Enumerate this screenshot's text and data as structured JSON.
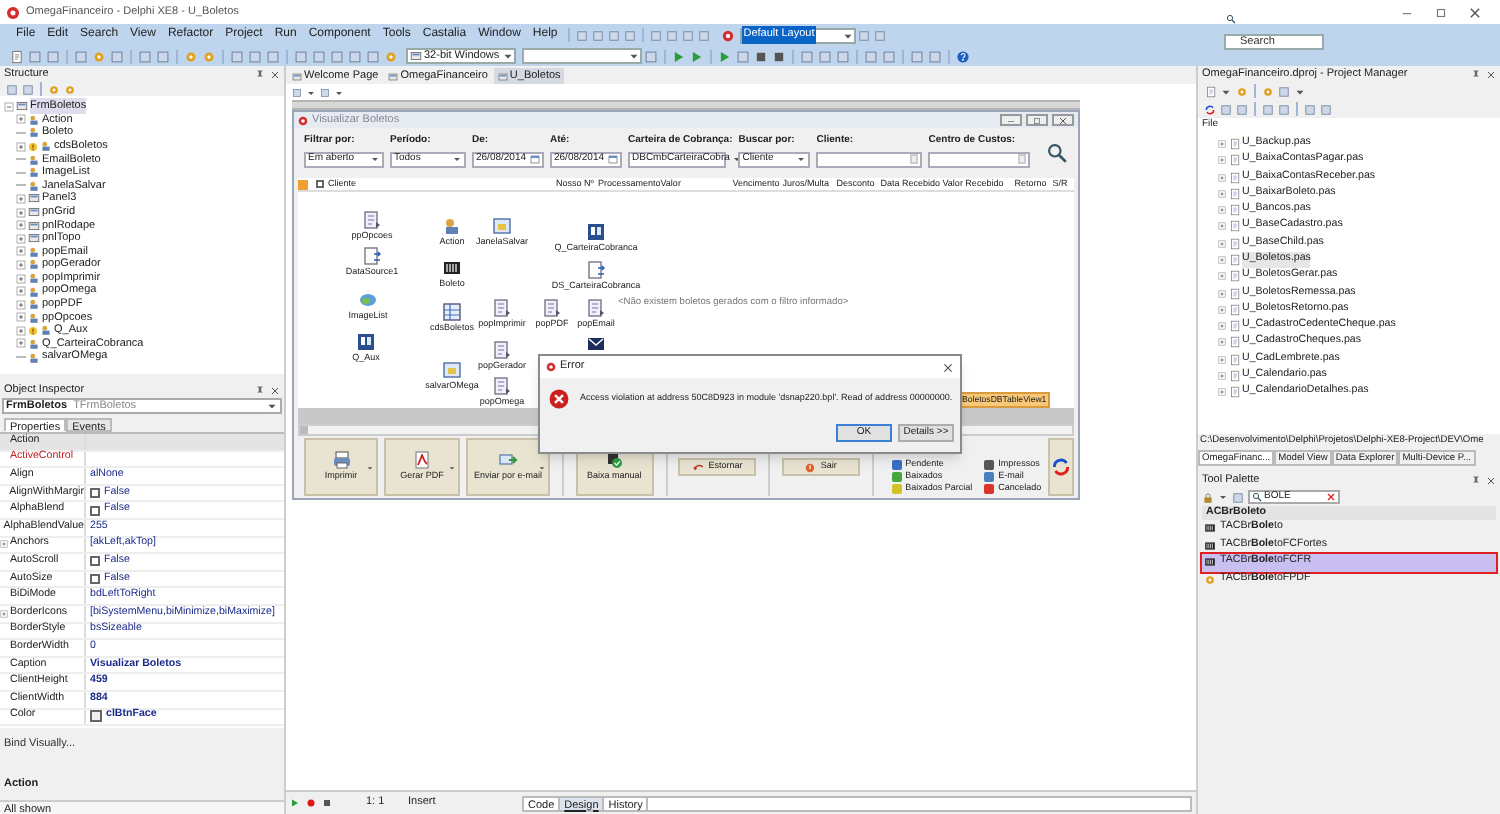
{
  "window": {
    "title": "OmegaFinanceiro - Delphi XE8 - U_Boletos"
  },
  "menu": [
    "File",
    "Edit",
    "Search",
    "View",
    "Refactor",
    "Project",
    "Run",
    "Component",
    "Tools",
    "Castalia",
    "Window",
    "Help"
  ],
  "layout_combo": {
    "value": "Default Layout"
  },
  "ide_search": {
    "placeholder": "Search"
  },
  "platform_combo": {
    "value": "32-bit Windows"
  },
  "structure": {
    "title": "Structure",
    "root": {
      "label": "FrmBoletos",
      "expanded": true,
      "children": [
        {
          "label": "Action",
          "kind": "component",
          "expandable": true,
          "warning": false
        },
        {
          "label": "Boleto",
          "kind": "component",
          "expandable": false,
          "warning": false
        },
        {
          "label": "cdsBoletos",
          "kind": "component",
          "expandable": true,
          "warning": true
        },
        {
          "label": "EmailBoleto",
          "kind": "component",
          "expandable": false,
          "warning": false
        },
        {
          "label": "ImageList",
          "kind": "component",
          "expandable": false,
          "warning": false
        },
        {
          "label": "JanelaSalvar",
          "kind": "component",
          "expandable": false,
          "warning": false
        },
        {
          "label": "Panel3",
          "kind": "panel",
          "expandable": true,
          "warning": false
        },
        {
          "label": "pnGrid",
          "kind": "panel",
          "expandable": true,
          "warning": false
        },
        {
          "label": "pnlRodape",
          "kind": "panel",
          "expandable": true,
          "warning": false
        },
        {
          "label": "pnlTopo",
          "kind": "panel",
          "expandable": true,
          "warning": false
        },
        {
          "label": "popEmail",
          "kind": "component",
          "expandable": true,
          "warning": false
        },
        {
          "label": "popGerador",
          "kind": "component",
          "expandable": true,
          "warning": false
        },
        {
          "label": "popImprimir",
          "kind": "component",
          "expandable": true,
          "warning": false
        },
        {
          "label": "popOmega",
          "kind": "component",
          "expandable": true,
          "warning": false
        },
        {
          "label": "popPDF",
          "kind": "component",
          "expandable": true,
          "warning": false
        },
        {
          "label": "ppOpcoes",
          "kind": "component",
          "expandable": true,
          "warning": false
        },
        {
          "label": "Q_Aux",
          "kind": "component",
          "expandable": true,
          "warning": true
        },
        {
          "label": "Q_CarteiraCobranca",
          "kind": "component",
          "expandable": true,
          "warning": false
        },
        {
          "label": "salvarOMega",
          "kind": "component",
          "expandable": false,
          "warning": false
        }
      ]
    }
  },
  "object_inspector": {
    "title": "Object Inspector",
    "component": "FrmBoletos",
    "class": "TFrmBoletos",
    "tabs": [
      {
        "label": "Properties",
        "selected": true
      },
      {
        "label": "Events",
        "selected": false
      }
    ],
    "properties": [
      {
        "name": "Action",
        "kind": "text",
        "selected": true,
        "expandable": false,
        "reference": false
      },
      {
        "name": "ActiveControl",
        "kind": "text",
        "selected": false,
        "expandable": false,
        "reference": true
      },
      {
        "name": "Align",
        "value": "alNone",
        "kind": "text",
        "selected": false,
        "expandable": false,
        "reference": false,
        "modified": false
      },
      {
        "name": "AlignWithMargir",
        "value": "False",
        "kind": "check",
        "checked": false,
        "selected": false,
        "expandable": false,
        "reference": false,
        "modified": false
      },
      {
        "name": "AlphaBlend",
        "value": "False",
        "kind": "check",
        "checked": false,
        "selected": false,
        "expandable": false,
        "reference": false,
        "modified": false
      },
      {
        "name": "AlphaBlendValue",
        "value": "255",
        "kind": "text",
        "selected": false,
        "expandable": false,
        "reference": false,
        "modified": false
      },
      {
        "name": "Anchors",
        "value": "[akLeft,akTop]",
        "kind": "text",
        "selected": false,
        "expandable": true,
        "reference": false,
        "modified": false
      },
      {
        "name": "AutoScroll",
        "value": "False",
        "kind": "check",
        "checked": false,
        "selected": false,
        "expandable": false,
        "reference": false,
        "modified": false
      },
      {
        "name": "AutoSize",
        "value": "False",
        "kind": "check",
        "checked": false,
        "selected": false,
        "expandable": false,
        "reference": false,
        "modified": false
      },
      {
        "name": "BiDiMode",
        "value": "bdLeftToRight",
        "kind": "text",
        "selected": false,
        "expandable": false,
        "reference": false,
        "modified": false
      },
      {
        "name": "BorderIcons",
        "value": "[biSystemMenu,biMinimize,biMaximize]",
        "kind": "text",
        "selected": false,
        "expandable": true,
        "reference": false,
        "modified": false
      },
      {
        "name": "BorderStyle",
        "value": "bsSizeable",
        "kind": "text",
        "selected": false,
        "expandable": false,
        "reference": false,
        "modified": false
      },
      {
        "name": "BorderWidth",
        "value": "0",
        "kind": "text",
        "selected": false,
        "expandable": false,
        "reference": false,
        "modified": false
      },
      {
        "name": "Caption",
        "value": "Visualizar Boletos",
        "kind": "text",
        "selected": false,
        "expandable": false,
        "reference": false,
        "modified": true
      },
      {
        "name": "ClientHeight",
        "value": "459",
        "kind": "text",
        "selected": false,
        "expandable": false,
        "reference": false,
        "modified": true
      },
      {
        "name": "ClientWidth",
        "value": "884",
        "kind": "text",
        "selected": false,
        "expandable": false,
        "reference": false,
        "modified": true
      },
      {
        "name": "Color",
        "value": "clBtnFace",
        "kind": "color",
        "selected": false,
        "expandable": false,
        "reference": false,
        "modified": true
      }
    ],
    "bind_link": "Bind Visually...",
    "help_title": "Action",
    "status": "All shown"
  },
  "editor_tabs": [
    {
      "label": "Welcome Page",
      "selected": false
    },
    {
      "label": "OmegaFinanceiro",
      "selected": false
    },
    {
      "label": "U_Boletos",
      "selected": true
    }
  ],
  "form": {
    "title": "Visualizar Boletos",
    "filters": [
      {
        "label": "Filtrar por:",
        "value": "Em aberto",
        "kind": "combo"
      },
      {
        "label": "Período:",
        "value": "Todos",
        "kind": "combo"
      },
      {
        "label": "De:",
        "value": "26/08/2014",
        "kind": "date"
      },
      {
        "label": "Até:",
        "value": "26/08/2014",
        "kind": "date"
      },
      {
        "label": "Carteira de Cobrança:",
        "value": "DBCmbCarteiraCobra",
        "kind": "combo"
      },
      {
        "label": "Buscar por:",
        "value": "Cliente",
        "kind": "combo"
      },
      {
        "label": "Cliente:",
        "kind": "edit"
      },
      {
        "label": "Centro de Custos:",
        "kind": "edit"
      }
    ],
    "grid": {
      "select_all_checked": false,
      "columns": [
        "Cliente",
        "Nosso Nº",
        "Processamento",
        "Valor",
        "Vencimento",
        "Juros/Multa",
        "Desconto",
        "Data Recebido",
        "Valor Recebido",
        "Retorno",
        "S/R"
      ],
      "empty_message": "<Não existem boletos gerados com o filtro informado>",
      "view_label": "BoletosDBTableView1"
    },
    "components": [
      {
        "label": "ppOpcoes",
        "kind": "popup"
      },
      {
        "label": "DataSource1",
        "kind": "datasource"
      },
      {
        "label": "ImageList",
        "kind": "imagelist"
      },
      {
        "label": "Q_Aux",
        "kind": "query"
      },
      {
        "label": "Action",
        "kind": "action"
      },
      {
        "label": "JanelaSalvar",
        "kind": "dialog"
      },
      {
        "label": "Boleto",
        "kind": "boleto"
      },
      {
        "label": "cdsBoletos",
        "kind": "dataset"
      },
      {
        "label": "salvarOMega",
        "kind": "dialog"
      },
      {
        "label": "popImprimir",
        "kind": "popup"
      },
      {
        "label": "popPDF",
        "kind": "popup"
      },
      {
        "label": "popEmail",
        "kind": "popup"
      },
      {
        "label": "popGerador",
        "kind": "popup"
      },
      {
        "label": "popOmega",
        "kind": "popup"
      },
      {
        "label": "Q_CarteiraCobranca",
        "kind": "query"
      },
      {
        "label": "DS_CarteiraCobranca",
        "kind": "datasource"
      },
      {
        "kind": "email"
      }
    ],
    "buttons": [
      {
        "label": "Imprimir",
        "dropdown": true
      },
      {
        "label": "Gerar PDF",
        "dropdown": true
      },
      {
        "label": "Enviar por e-mail",
        "dropdown": true
      },
      {
        "label": "Baixa manual",
        "dropdown": false
      },
      {
        "label": "Estornar",
        "dropdown": false
      },
      {
        "label": "Sair",
        "dropdown": false
      }
    ],
    "legend": [
      {
        "label": "Pendente",
        "color": "#3b6fc6"
      },
      {
        "label": "Baixados",
        "color": "#46a83c"
      },
      {
        "label": "Baixados Parcial",
        "color": "#d2c226"
      },
      {
        "label": "Impressos",
        "color": "#555555"
      },
      {
        "label": "E-mail",
        "color": "#4a7fc1"
      },
      {
        "label": "Cancelado",
        "color": "#d9362b"
      }
    ]
  },
  "error_dialog": {
    "title": "Error",
    "message": "Access violation at address 50C8D923 in module 'dsnap220.bpl'. Read of address 00000000.",
    "buttons": [
      {
        "label": "OK",
        "default": true
      },
      {
        "label": "Details >>",
        "default": false
      }
    ]
  },
  "editor_status": {
    "position": "1: 1",
    "mode": "Insert",
    "tabs": [
      {
        "label": "Code",
        "selected": false
      },
      {
        "label": "Design",
        "selected": true
      },
      {
        "label": "History",
        "selected": false
      }
    ]
  },
  "project_manager": {
    "title": "OmegaFinanceiro.dproj - Project Manager",
    "column": "File",
    "files": [
      {
        "label": "U_Backup.pas",
        "selected": false
      },
      {
        "label": "U_BaixaContasPagar.pas",
        "selected": false
      },
      {
        "label": "U_BaixaContasReceber.pas",
        "selected": false
      },
      {
        "label": "U_BaixarBoleto.pas",
        "selected": false
      },
      {
        "label": "U_Bancos.pas",
        "selected": false
      },
      {
        "label": "U_BaseCadastro.pas",
        "selected": false
      },
      {
        "label": "U_BaseChild.pas",
        "selected": false
      },
      {
        "label": "U_Boletos.pas",
        "selected": true
      },
      {
        "label": "U_BoletosGerar.pas",
        "selected": false
      },
      {
        "label": "U_BoletosRemessa.pas",
        "selected": false
      },
      {
        "label": "U_BoletosRetorno.pas",
        "selected": false
      },
      {
        "label": "U_CadastroCedenteCheque.pas",
        "selected": false
      },
      {
        "label": "U_CadastroCheques.pas",
        "selected": false
      },
      {
        "label": "U_CadLembrete.pas",
        "selected": false
      },
      {
        "label": "U_Calendario.pas",
        "selected": false
      },
      {
        "label": "U_CalendarioDetalhes.pas",
        "selected": false
      }
    ],
    "path": "C:\\Desenvolvimento\\Delphi\\Projetos\\Delphi-XE8-Project\\DEV\\Ome",
    "tabs": [
      {
        "label": "OmegaFinanc...",
        "selected": true
      },
      {
        "label": "Model View",
        "selected": false
      },
      {
        "label": "Data Explorer",
        "selected": false
      },
      {
        "label": "Multi-Device P...",
        "selected": false
      }
    ]
  },
  "tool_palette": {
    "title": "Tool Palette",
    "search": "BOLE",
    "group": "ACBrBoleto",
    "items": [
      {
        "label": "TACBr**Bole**to",
        "selected": false
      },
      {
        "label": "TACBr**Bole**toFCFortes",
        "selected": false
      },
      {
        "label": "TACBr**Bole**toFCFR",
        "selected": true
      },
      {
        "label": "TACBr**Bole**toFPDF",
        "selected": false
      }
    ]
  }
}
